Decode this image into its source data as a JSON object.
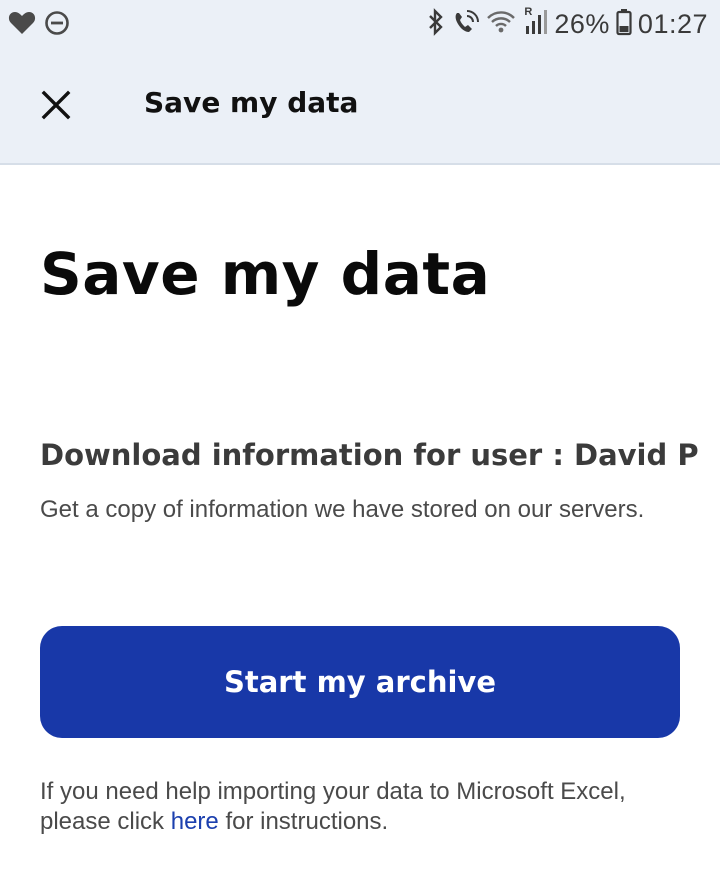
{
  "status_bar": {
    "battery": "26%",
    "time": "01:27",
    "signal_label": "R",
    "icons": [
      "heart-icon",
      "do-not-disturb-icon",
      "bluetooth-icon",
      "wifi-calling-icon",
      "wifi-icon",
      "signal-icon",
      "battery-icon"
    ]
  },
  "app_bar": {
    "title": "Save my data",
    "close_icon": "close-icon"
  },
  "main": {
    "heading": "Save my data",
    "section_title": "Download information for user : David P",
    "section_desc": "Get a copy of information we have stored on our servers.",
    "archive_button_label": "Start my archive",
    "help_text_before": "If you need help importing your data to Microsoft Excel, please click ",
    "help_link": "here",
    "help_text_after": " for instructions."
  },
  "colors": {
    "header_bg": "#ebf0f7",
    "button_bg": "#1838a8",
    "link": "#1b3fae"
  }
}
